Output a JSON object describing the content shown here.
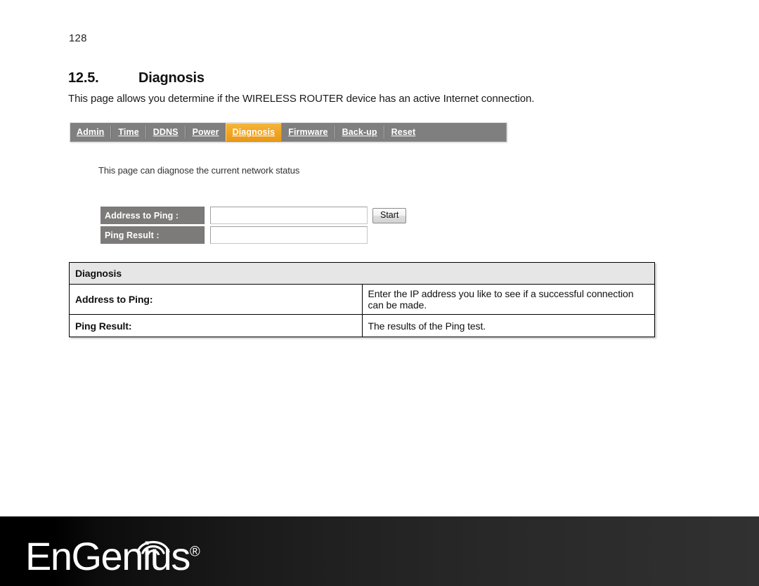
{
  "document": {
    "page_number": "128",
    "section_number": "12.5.",
    "section_title": "Diagnosis",
    "intro_text": "This page allows you determine if the WIRELESS ROUTER device has an active Internet connection."
  },
  "tabs": {
    "active": "Diagnosis",
    "items": [
      {
        "label": "Admin"
      },
      {
        "label": "Time"
      },
      {
        "label": "DDNS"
      },
      {
        "label": "Power"
      },
      {
        "label": "Diagnosis"
      },
      {
        "label": "Firmware"
      },
      {
        "label": "Back-up"
      },
      {
        "label": "Reset"
      }
    ]
  },
  "panel": {
    "note": "This page can diagnose the current network status",
    "fields": [
      {
        "label": "Address to Ping :",
        "value": "",
        "placeholder": ""
      },
      {
        "label": "Ping Result :",
        "value": "",
        "placeholder": ""
      }
    ],
    "start_button": "Start"
  },
  "description_table": {
    "header": "Diagnosis",
    "rows": [
      {
        "key": "Address to Ping:",
        "value": "Enter the IP address you like to see if a successful connection can be made."
      },
      {
        "key": "Ping Result:",
        "value": "The results of the Ping test."
      }
    ]
  },
  "footer": {
    "brand_part1": "EnGenius",
    "brand_reg": "®"
  },
  "colors": {
    "tab_bar_bg": "#7f7f7f",
    "tab_active_bg": "#f0a423",
    "form_label_bg": "#7d7a7a",
    "table_header_bg": "#e6e6e6",
    "footer_bg": "#1a1a1a"
  }
}
